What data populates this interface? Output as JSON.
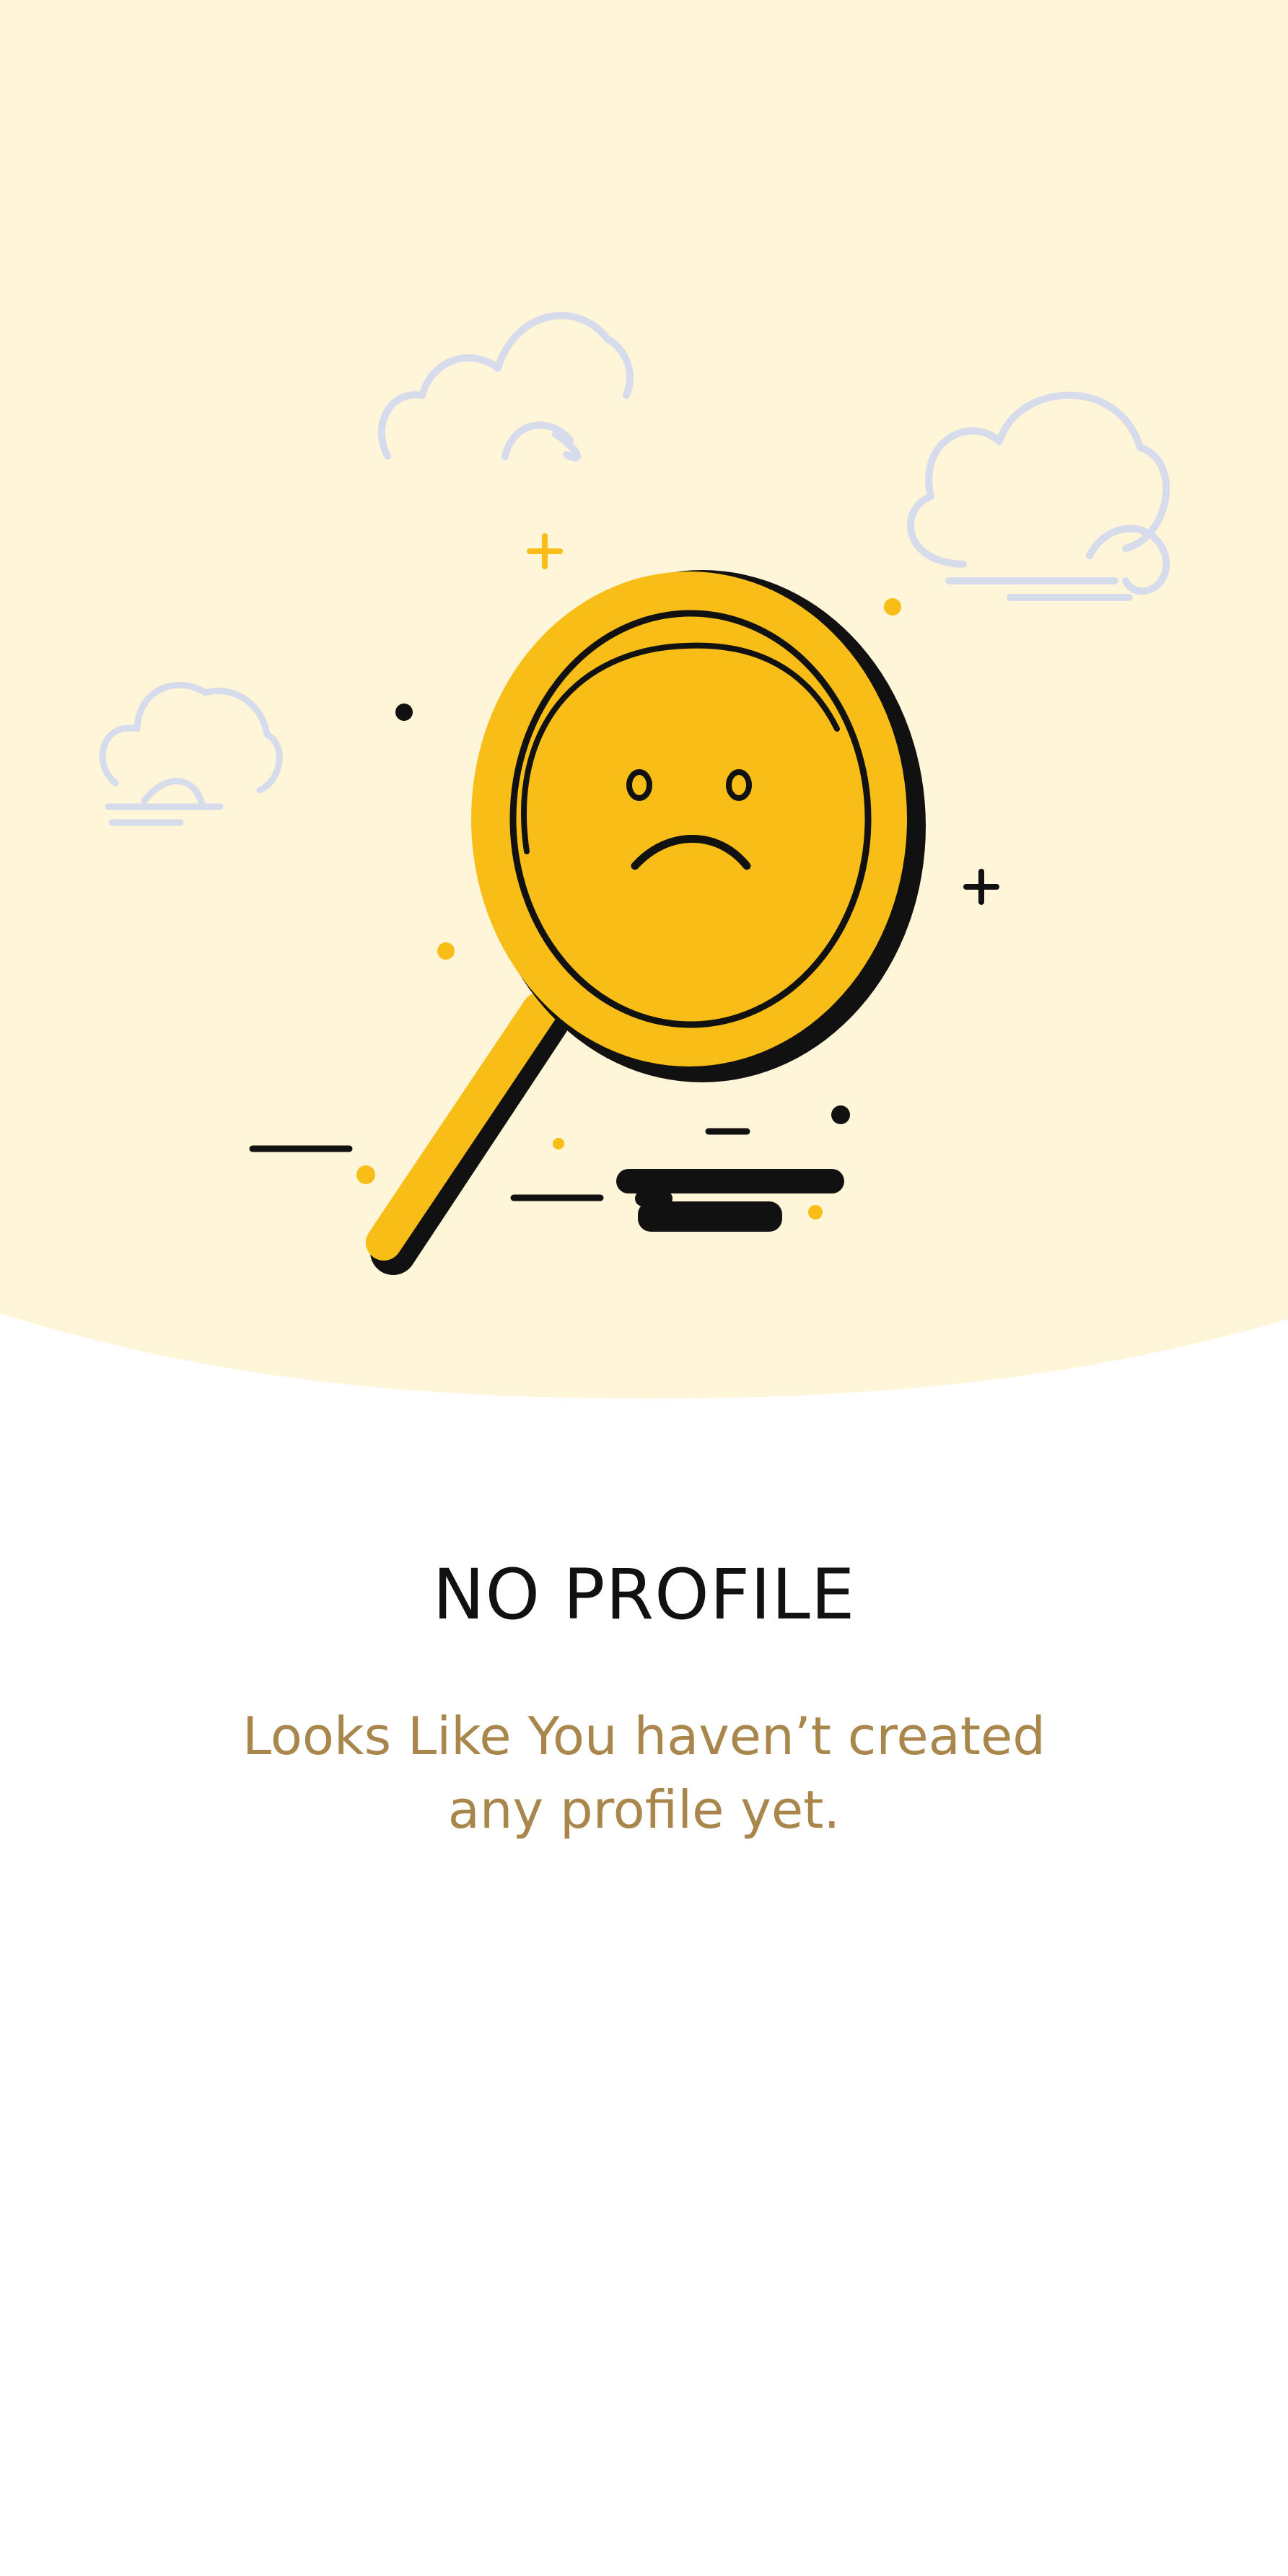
{
  "empty_state": {
    "title": "NO PROFILE",
    "message": "Looks Like You haven’t created any profile yet.",
    "illustration": {
      "icon": "sad-face-magnifying-glass-icon",
      "clouds": [
        "cloud-icon",
        "cloud-icon",
        "cloud-icon"
      ]
    }
  },
  "colors": {
    "hero_background": "#fff5d9",
    "page_background": "#ffffff",
    "accent_yellow": "#f8bd16",
    "title_text": "#111111",
    "message_text": "#a9874c",
    "outline": "#111111",
    "cloud_stroke": "#d7dcec"
  }
}
